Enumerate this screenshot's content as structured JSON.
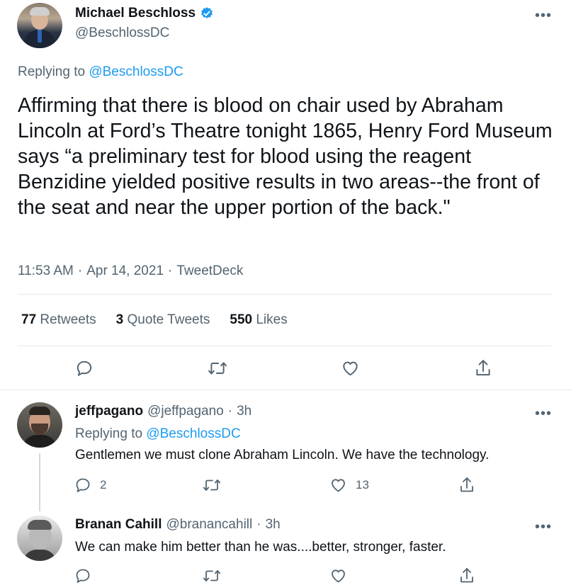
{
  "main_tweet": {
    "author_name": "Michael Beschloss",
    "author_handle": "@BeschlossDC",
    "replying_prefix": "Replying to",
    "replying_to": "@BeschlossDC",
    "text": "Affirming that there is blood on chair used by Abraham Lincoln at Ford’s Theatre tonight 1865, Henry Ford Museum says “a preliminary test for blood using the reagent Benzidine yielded positive results in two areas--the front of the seat and near the upper portion of the back.\"",
    "time": "11:53 AM",
    "date": "Apr 14, 2021",
    "source": "TweetDeck",
    "sep": "·",
    "stats": {
      "retweets_count": "77",
      "retweets_label": "Retweets",
      "quotes_count": "3",
      "quotes_label": "Quote Tweets",
      "likes_count": "550",
      "likes_label": "Likes"
    }
  },
  "replies": [
    {
      "author_name": "jeffpagano",
      "author_handle": "@jeffpagano",
      "time": "3h",
      "replying_prefix": "Replying to",
      "replying_to": "@BeschlossDC",
      "text": "Gentlemen we must clone Abraham Lincoln. We have the technology.",
      "reply_count": "2",
      "retweet_count": "",
      "like_count": "13"
    },
    {
      "author_name": "Branan Cahill",
      "author_handle": "@branancahill",
      "time": "3h",
      "text": "We can make him better than he was....better, stronger, faster."
    }
  ],
  "icons": {
    "verified": "verified-badge-icon",
    "more": "more-icon",
    "reply": "reply-icon",
    "retweet": "retweet-icon",
    "like": "like-icon",
    "share": "share-icon"
  },
  "colors": {
    "accent": "#1d9bf0",
    "text": "#0f1419",
    "muted": "#536471",
    "divider": "#e6e9ec"
  }
}
